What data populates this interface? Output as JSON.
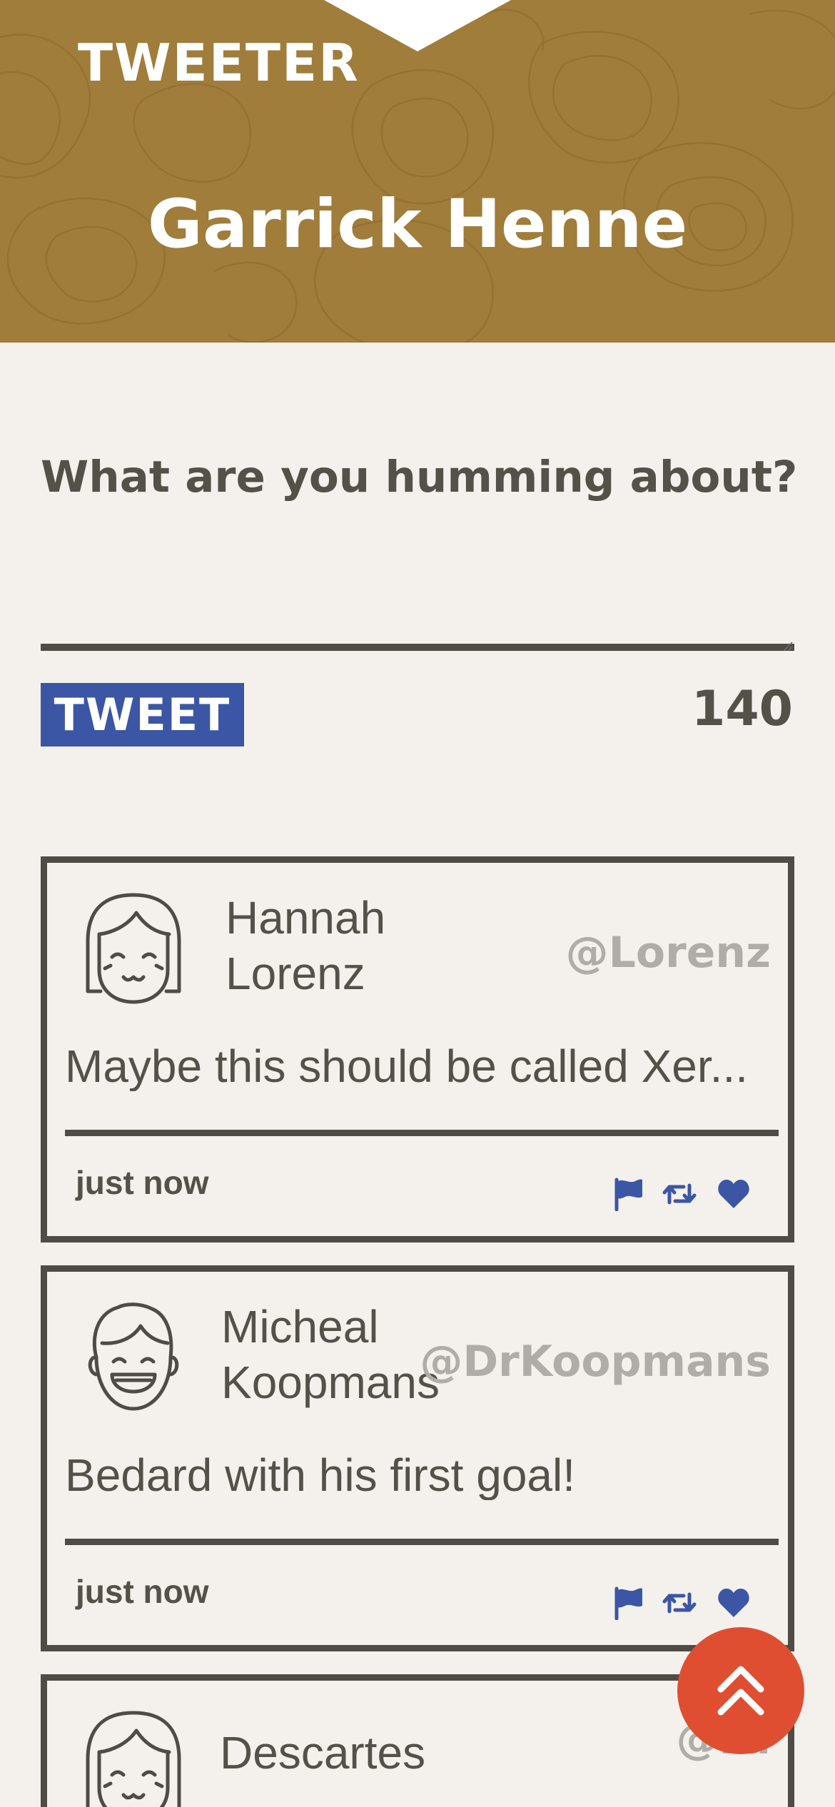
{
  "header": {
    "brand": "TWEETER",
    "profile_name": "Garrick Henne",
    "background_color": "#a07d3a"
  },
  "composer": {
    "label": "What are you humming about?",
    "input_value": "",
    "tweet_button_label": "TWEET",
    "char_counter": "140",
    "button_color": "#3b56a5"
  },
  "tweets": [
    {
      "author_name": "Hannah\nLorenz",
      "handle": "@Lorenz",
      "text": "Maybe this should be called Xer...",
      "timestamp": "just now",
      "avatar_icon": "girl-face-icon",
      "actions": [
        "flag-icon",
        "retweet-icon",
        "heart-icon"
      ]
    },
    {
      "author_name": "Micheal\nKoopmans",
      "handle": "@DrKoopmans",
      "text": "Bedard with his first goal!",
      "timestamp": "just now",
      "avatar_icon": "boy-face-icon",
      "actions": [
        "flag-icon",
        "retweet-icon",
        "heart-icon"
      ]
    },
    {
      "author_name": "Descartes",
      "handle": "@rd",
      "avatar_icon": "girl-face-icon"
    }
  ],
  "scroll_top_button": {
    "icon": "double-chevron-up-icon",
    "color": "#e04e32"
  },
  "colors": {
    "text": "#545149",
    "action_icons": "#3b56a5",
    "handle": "#b0ada8",
    "page_background": "#f4f1ed"
  }
}
